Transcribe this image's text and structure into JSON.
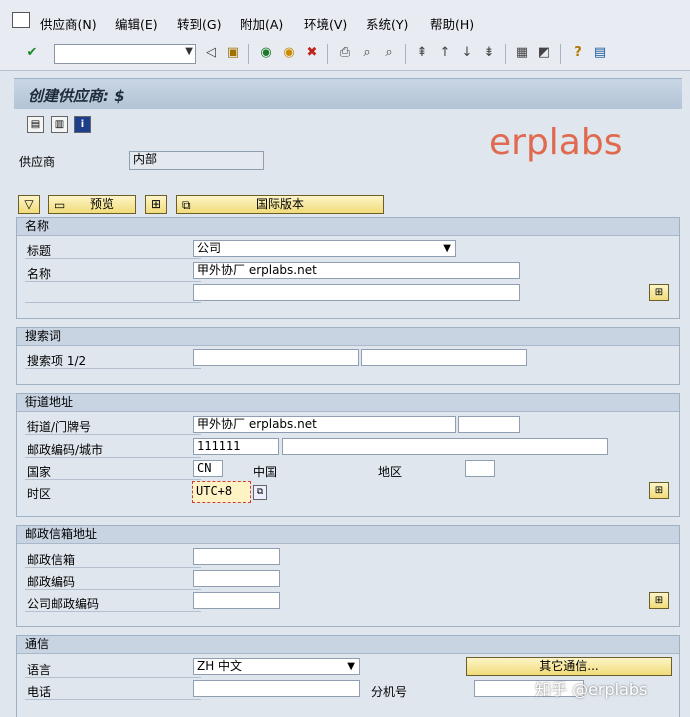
{
  "menu": {
    "items": [
      "供应商(N)",
      "编辑(E)",
      "转到(G)",
      "附加(A)",
      "环境(V)",
      "系统(Y)",
      "帮助(H)"
    ]
  },
  "toolbar": {
    "command_field_value": "",
    "icons": [
      "enter-check-icon",
      "back-icon",
      "save-icon",
      "back-green-icon",
      "exit-icon",
      "cancel-icon",
      "print-icon",
      "find-icon",
      "find-next-icon",
      "first-page-icon",
      "prev-page-icon",
      "next-page-icon",
      "last-page-icon",
      "create-session-icon",
      "shortcut-icon",
      "help-icon",
      "layout-icon"
    ]
  },
  "title": "创建供应商: $",
  "app_toolbar": {
    "icons": [
      "details-icon",
      "details2-icon",
      "info-icon"
    ]
  },
  "vendor": {
    "label": "供应商",
    "value": "内部"
  },
  "actions": {
    "preview": "预览",
    "intl_version": "国际版本"
  },
  "sections": {
    "name": {
      "header": "名称",
      "title_label": "标题",
      "title_value": "公司",
      "name_label": "名称",
      "name_value": "甲外协厂 erplabs.net",
      "name2_value": ""
    },
    "search": {
      "header": "搜索词",
      "label": "搜索项 1/2",
      "value1": "",
      "value2": ""
    },
    "street": {
      "header": "街道地址",
      "street_label": "街道/门牌号",
      "street_value": "甲外协厂 erplabs.net",
      "house_no": "",
      "postal_label": "邮政编码/城市",
      "postal_value": "111111",
      "city_value": "",
      "country_label": "国家",
      "country_code": "CN",
      "country_name": "中国",
      "region_label": "地区",
      "region_value": "",
      "tz_label": "时区",
      "tz_value": "UTC+8"
    },
    "pobox": {
      "header": "邮政信箱地址",
      "pobox_label": "邮政信箱",
      "pobox_value": "",
      "postal_label": "邮政编码",
      "postal_value": "",
      "company_postal_label": "公司邮政编码",
      "company_postal_value": ""
    },
    "comm": {
      "header": "通信",
      "lang_label": "语言",
      "lang_value": "ZH 中文",
      "other_button": "其它通信...",
      "phone_label": "电话",
      "phone_value": "",
      "ext_label": "分机号",
      "ext_value": ""
    }
  },
  "watermark": "erplabs",
  "watermark_zhihu": "知乎 @erplabs",
  "colors": {
    "watermark": "#e06a4f",
    "button_yellow": "#f1dc7a",
    "header_blue": "#c8d4e1"
  }
}
